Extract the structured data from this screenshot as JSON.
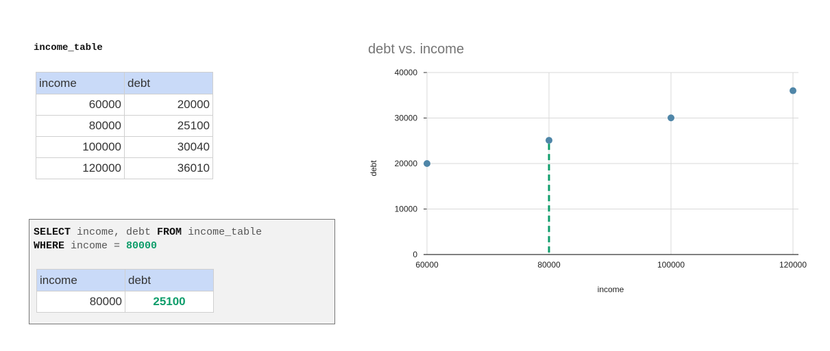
{
  "table_name": "income_table",
  "income_table": {
    "headers": [
      "income",
      "debt"
    ],
    "rows": [
      [
        "60000",
        "20000"
      ],
      [
        "80000",
        "25100"
      ],
      [
        "100000",
        "30040"
      ],
      [
        "120000",
        "36010"
      ]
    ]
  },
  "query": {
    "kw_select": "SELECT",
    "select_cols": " income, debt ",
    "kw_from": "FROM",
    "from_table": " income_table",
    "kw_where": "WHERE",
    "where_cond": " income = ",
    "where_value": "80000"
  },
  "result_table": {
    "headers": [
      "income",
      "debt"
    ],
    "row": [
      "80000",
      "25100"
    ]
  },
  "colors": {
    "highlight": "#0f9d6b",
    "point": "#4f86a8",
    "header_bg": "#c9daf8"
  },
  "chart_data": {
    "type": "scatter",
    "title": "debt vs. income",
    "xlabel": "income",
    "ylabel": "debt",
    "x": [
      60000,
      80000,
      100000,
      120000
    ],
    "y": [
      20000,
      25100,
      30040,
      36010
    ],
    "xlim": [
      60000,
      120000
    ],
    "ylim": [
      0,
      40000
    ],
    "xticks": [
      "60000",
      "80000",
      "100000",
      "120000"
    ],
    "yticks": [
      "0",
      "10000",
      "20000",
      "30000",
      "40000"
    ],
    "grid": true,
    "highlight": {
      "x": 80000,
      "y": 25100,
      "style": "dashed-drop-line"
    }
  }
}
